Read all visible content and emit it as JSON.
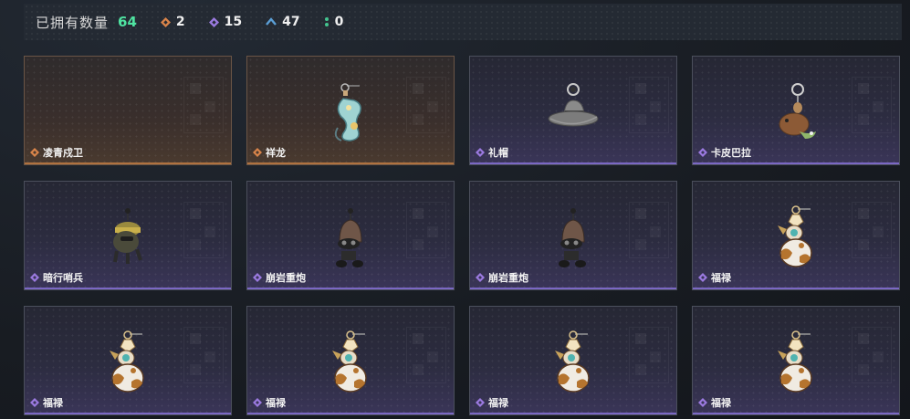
{
  "header": {
    "owned_label": "已拥有数量",
    "owned_count": "64",
    "stats": [
      {
        "icon": "orange-diamond-icon",
        "value": "2",
        "color": "#d9844a"
      },
      {
        "icon": "purple-diamond-icon",
        "value": "15",
        "color": "#9b7ae0"
      },
      {
        "icon": "blue-chevron-icon",
        "value": "47",
        "color": "#5b9fd6"
      },
      {
        "icon": "green-dots-icon",
        "value": "0",
        "color": "#43c48f"
      }
    ]
  },
  "cards": [
    {
      "name": "凌青戍卫",
      "rarity": "orange",
      "charm": "none"
    },
    {
      "name": "祥龙",
      "rarity": "orange",
      "charm": "dragon"
    },
    {
      "name": "礼帽",
      "rarity": "purple",
      "charm": "hat"
    },
    {
      "name": "卡皮巴拉",
      "rarity": "purple",
      "charm": "capybara"
    },
    {
      "name": "暗行哨兵",
      "rarity": "purple",
      "charm": "sentinel"
    },
    {
      "name": "崩岩重炮",
      "rarity": "purple",
      "charm": "cannon"
    },
    {
      "name": "崩岩重炮",
      "rarity": "purple",
      "charm": "cannon"
    },
    {
      "name": "福禄",
      "rarity": "purple",
      "charm": "gourd"
    },
    {
      "name": "福禄",
      "rarity": "purple",
      "charm": "gourd"
    },
    {
      "name": "福禄",
      "rarity": "purple",
      "charm": "gourd"
    },
    {
      "name": "福禄",
      "rarity": "purple",
      "charm": "gourd"
    },
    {
      "name": "福禄",
      "rarity": "purple",
      "charm": "gourd"
    }
  ]
}
